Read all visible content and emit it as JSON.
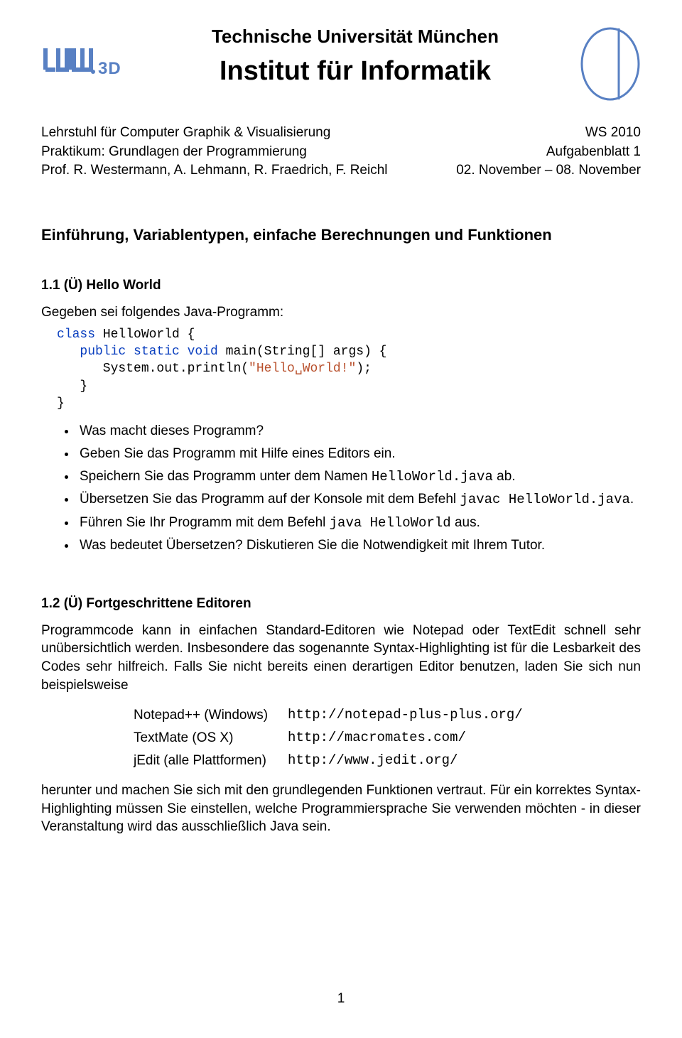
{
  "header": {
    "uni": "Technische Universität München",
    "inst": "Institut für Informatik"
  },
  "meta": {
    "left1": "Lehrstuhl für Computer Graphik & Visualisierung",
    "left2": "Praktikum: Grundlagen der Programmierung",
    "left3": "Prof. R. Westermann, A. Lehmann, R. Fraedrich, F. Reichl",
    "right1": "WS 2010",
    "right2": "Aufgabenblatt 1",
    "right3": "02. November – 08. November"
  },
  "section_title": "Einführung, Variablentypen, einfache Berechnungen und Funktionen",
  "ex1": {
    "title": "1.1 (Ü) Hello World",
    "intro": "Gegeben sei folgendes Java-Programm:",
    "code": {
      "l1a": "class",
      "l1b": " HelloWorld {",
      "l2a": "   public static void",
      "l2b": " main(String[] args) {",
      "l3a": "      System.out.println(",
      "l3s": "\"Hello␣World!\"",
      "l3b": ");",
      "l4": "   }",
      "l5": "}"
    },
    "bullets": [
      "Was macht dieses Programm?",
      "Geben Sie das Programm mit Hilfe eines Editors ein.",
      "Speichern Sie das Programm unter dem Namen HelloWorld.java ab.",
      "Übersetzen Sie das Programm auf der Konsole mit dem Befehl javac HelloWorld.java.",
      "Führen Sie Ihr Programm mit dem Befehl java HelloWorld aus.",
      "Was bedeutet Übersetzen? Diskutieren Sie die Notwendigkeit mit Ihrem Tutor."
    ],
    "bullets_tt": {
      "2": [
        "HelloWorld.java"
      ],
      "3": [
        "javac HelloWorld.java"
      ],
      "4": [
        "java HelloWorld"
      ]
    }
  },
  "ex2": {
    "title": "1.2 (Ü) Fortgeschrittene Editoren",
    "para1": "Programmcode kann in einfachen Standard-Editoren wie Notepad oder TextEdit schnell sehr unübersichtlich werden. Insbesondere das sogenannte Syntax-Highlighting ist für die Lesbarkeit des Codes sehr hilfreich. Falls Sie nicht bereits einen derartigen Editor benutzen, laden Sie sich nun beispielsweise",
    "editors": [
      {
        "name": "Notepad++ (Windows)",
        "url": "http://notepad-plus-plus.org/"
      },
      {
        "name": "TextMate (OS X)",
        "url": "http://macromates.com/"
      },
      {
        "name": "jEdit (alle Plattformen)",
        "url": "http://www.jedit.org/"
      }
    ],
    "para2": "herunter und machen Sie sich mit den grundlegenden Funktionen vertraut. Für ein korrektes Syntax-Highlighting müssen Sie einstellen, welche Programmiersprache Sie verwenden möchten - in dieser Veranstaltung wird das ausschließlich Java sein."
  },
  "page_num": "1"
}
